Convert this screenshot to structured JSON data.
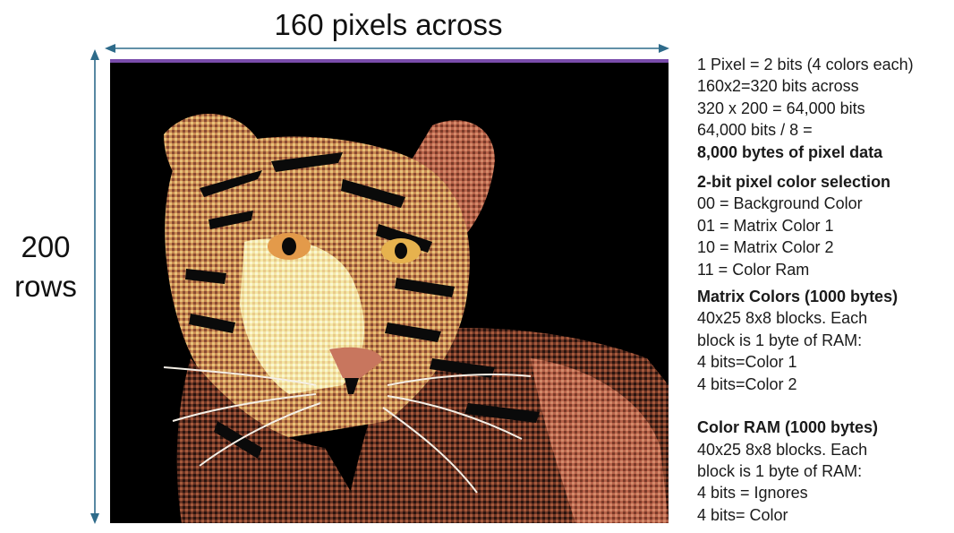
{
  "dimension_labels": {
    "across": "160 pixels across",
    "rows_number": "200",
    "rows_word": "rows"
  },
  "colors": {
    "arrow": "#2e6b8a",
    "frame_top_bar": "#7a4cab",
    "background": "#000000"
  },
  "image": {
    "subject": "tiger-face-multicolor-bitmap"
  },
  "notes": {
    "pixel_bits": "1 Pixel = 2 bits (4 colors each)",
    "bits_across": "160x2=320 bits across",
    "total_bits": "320 x 200 = 64,000 bits",
    "bits_to_bytes": "64,000 bits / 8 =",
    "bytes_total": "8,000 bytes of pixel data",
    "selection_heading": "2-bit pixel color selection",
    "selection_items": [
      "00 = Background Color",
      "01 = Matrix Color 1",
      "10 = Matrix Color 2",
      "11 = Color Ram"
    ],
    "matrix_heading": "Matrix Colors (1000 bytes)",
    "matrix_lines": [
      "40x25 8x8 blocks.  Each",
      "block is 1 byte of RAM:",
      "4 bits=Color 1",
      "4 bits=Color 2"
    ],
    "colorram_heading": "Color RAM (1000 bytes)",
    "colorram_lines": [
      "40x25 8x8 blocks.  Each",
      "block is 1 byte of RAM:",
      "4 bits = Ignores",
      "4 bits= Color"
    ]
  }
}
